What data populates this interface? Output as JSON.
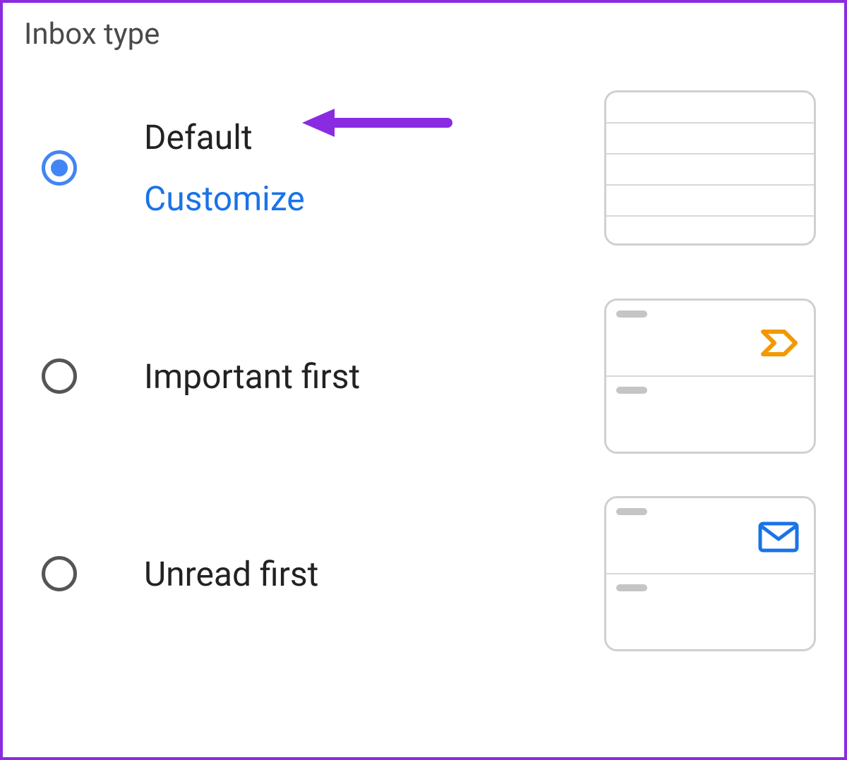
{
  "section_title": "Inbox type",
  "options": [
    {
      "label": "Default",
      "customize": "Customize",
      "selected": true
    },
    {
      "label": "Important first",
      "selected": false
    },
    {
      "label": "Unread first",
      "selected": false
    }
  ],
  "colors": {
    "accent_blue": "#1a73e8",
    "radio_blue": "#4285f4",
    "important_orange": "#f29900",
    "annotation_purple": "#8a2be2"
  }
}
